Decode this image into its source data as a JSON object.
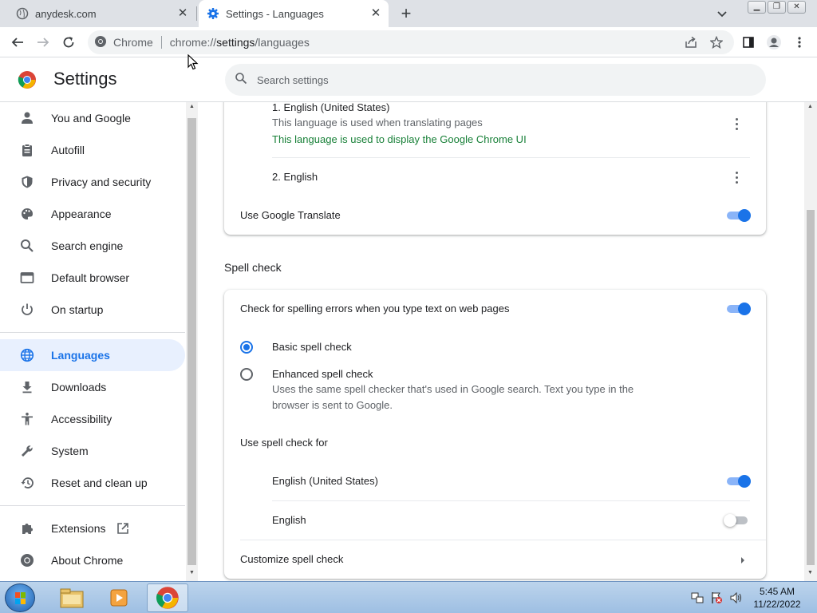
{
  "tabs": [
    {
      "title": "anydesk.com",
      "active": false
    },
    {
      "title": "Settings - Languages",
      "active": true
    }
  ],
  "toolbar": {
    "site_label": "Chrome",
    "url_scheme": "chrome://",
    "url_host": "settings",
    "url_path": "/languages"
  },
  "header": {
    "title": "Settings",
    "search_placeholder": "Search settings"
  },
  "sidebar": {
    "items": [
      {
        "label": "You and Google",
        "icon": "person-icon"
      },
      {
        "label": "Autofill",
        "icon": "clipboard-icon"
      },
      {
        "label": "Privacy and security",
        "icon": "shield-icon"
      },
      {
        "label": "Appearance",
        "icon": "palette-icon"
      },
      {
        "label": "Search engine",
        "icon": "search-icon"
      },
      {
        "label": "Default browser",
        "icon": "browser-icon"
      },
      {
        "label": "On startup",
        "icon": "power-icon"
      },
      {
        "label": "Languages",
        "icon": "globe-icon",
        "active": true
      },
      {
        "label": "Downloads",
        "icon": "download-icon"
      },
      {
        "label": "Accessibility",
        "icon": "accessibility-icon"
      },
      {
        "label": "System",
        "icon": "wrench-icon"
      },
      {
        "label": "Reset and clean up",
        "icon": "restore-icon"
      },
      {
        "label": "Extensions",
        "icon": "puzzle-icon"
      },
      {
        "label": "About Chrome",
        "icon": "chrome-icon"
      }
    ]
  },
  "languages": {
    "items": [
      {
        "label": "1. English (United States)",
        "note": "This language is used when translating pages",
        "note2": "This language is used to display the Google Chrome UI"
      },
      {
        "label": "2. English"
      }
    ],
    "translate_label": "Use Google Translate",
    "translate_on": true
  },
  "spellcheck": {
    "section_title": "Spell check",
    "check_label": "Check for spelling errors when you type text on web pages",
    "check_on": true,
    "basic_label": "Basic spell check",
    "basic_selected": true,
    "enhanced_label": "Enhanced spell check",
    "enhanced_desc_1": "Uses the same spell checker that's used in Google search. Text you type in the",
    "enhanced_desc_2": "browser is sent to Google.",
    "use_for_label": "Use spell check for",
    "languages": [
      {
        "label": "English (United States)",
        "on": true
      },
      {
        "label": "English",
        "on": false
      }
    ],
    "customize_label": "Customize spell check"
  },
  "taskbar": {
    "time": "5:45 AM",
    "date": "11/22/2022"
  },
  "colors": {
    "accent": "#1a73e8",
    "active_bg": "#e8f0fe",
    "green_note": "#188038"
  }
}
